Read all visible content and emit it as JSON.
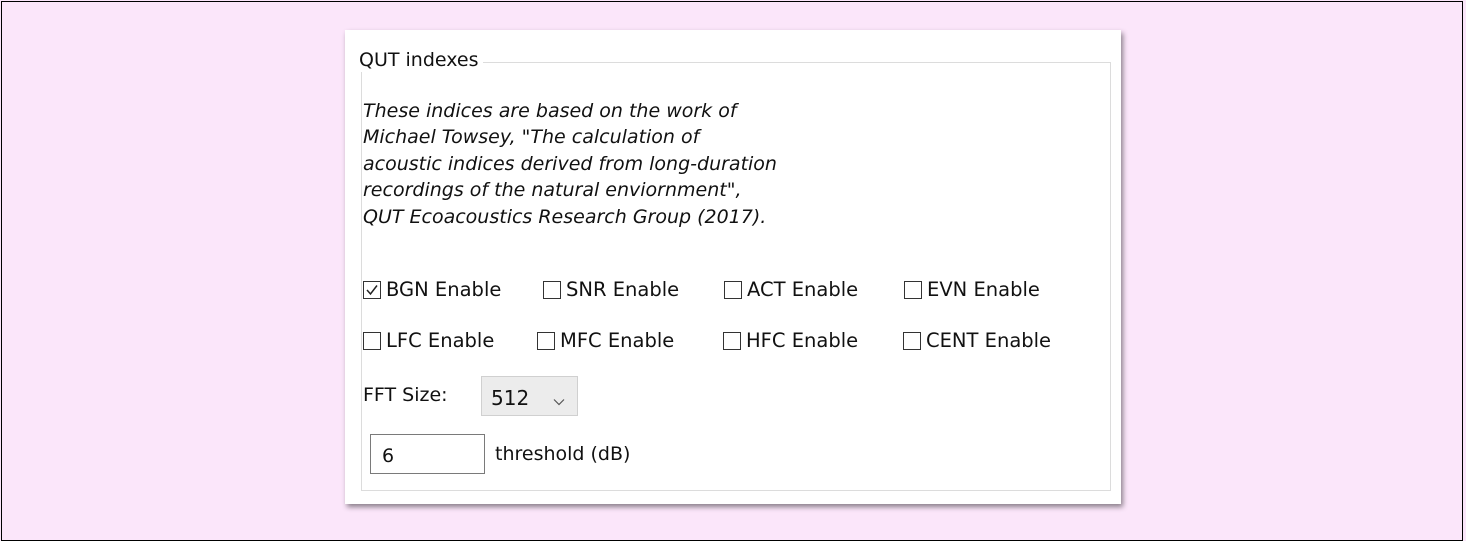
{
  "group": {
    "title": "QUT indexes",
    "description": [
      "These indices are based on the work of",
      "Michael Towsey, \"The calculation of",
      "acoustic indices derived from long-duration",
      "recordings of the natural enviornment\",",
      "QUT Ecoacoustics Research Group (2017)."
    ]
  },
  "checkboxes": {
    "row1": [
      {
        "label": "BGN Enable",
        "checked": true
      },
      {
        "label": "SNR Enable",
        "checked": false
      },
      {
        "label": "ACT Enable",
        "checked": false
      },
      {
        "label": "EVN Enable",
        "checked": false
      }
    ],
    "row2": [
      {
        "label": "LFC Enable",
        "checked": false
      },
      {
        "label": "MFC Enable",
        "checked": false
      },
      {
        "label": "HFC Enable",
        "checked": false
      },
      {
        "label": "CENT Enable",
        "checked": false
      }
    ]
  },
  "fft": {
    "label": "FFT Size:",
    "value": "512"
  },
  "threshold": {
    "value": "6",
    "label": "threshold (dB)"
  },
  "colors": {
    "background": "#fbe6fa",
    "panel": "#ffffff",
    "select_bg": "#ececec"
  }
}
